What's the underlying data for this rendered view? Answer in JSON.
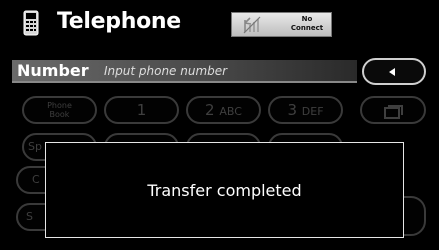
{
  "header": {
    "title": "Telephone",
    "connection_status": "No Connect",
    "connection_status_line1": "No",
    "connection_status_line2": "Connect"
  },
  "number_bar": {
    "label": "Number",
    "hint": "Input phone number"
  },
  "keypad": {
    "phonebook_line1": "Phone",
    "phonebook_line2": "Book",
    "key_1": "1",
    "key_2": "2",
    "key_2_letters": "ABC",
    "key_3": "3",
    "key_3_letters": "DEF",
    "partial_sp": "Sp",
    "partial_c": "C",
    "partial_s": "S"
  },
  "dialog": {
    "message": "Transfer completed"
  },
  "icons": {
    "phone": "telephone-icon",
    "signal": "antenna-no-signal-icon",
    "back": "back-arrow-icon",
    "dial": "dial-icon"
  },
  "colors": {
    "background": "#000000",
    "text": "#ffffff",
    "dimmed_key": "#3a3a3a",
    "dialog_border": "#e6e6e6"
  }
}
